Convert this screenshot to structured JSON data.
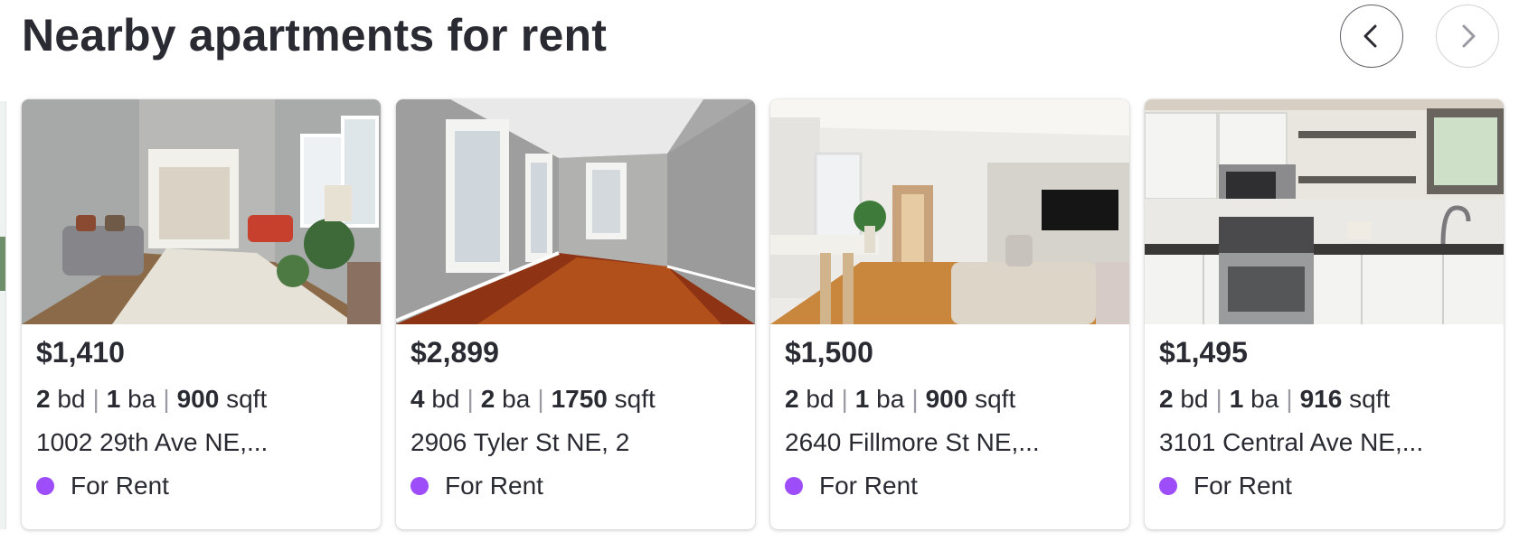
{
  "header": {
    "title": "Nearby apartments for rent",
    "prev_icon": "chevron-left-icon",
    "next_icon": "chevron-right-icon"
  },
  "colors": {
    "text": "#2a2a33",
    "status_dot": "#9e4dfb",
    "separator": "#9a9aa2"
  },
  "listings": [
    {
      "price": "$1,410",
      "beds": "2",
      "beds_unit": "bd",
      "baths": "1",
      "baths_unit": "ba",
      "sqft": "900",
      "sqft_unit": "sqft",
      "address": "1002 29th Ave NE,...",
      "status": "For Rent",
      "photo": "living-room-photo"
    },
    {
      "price": "$2,899",
      "beds": "4",
      "beds_unit": "bd",
      "baths": "2",
      "baths_unit": "ba",
      "sqft": "1750",
      "sqft_unit": "sqft",
      "address": "2906 Tyler St NE, 2",
      "status": "For Rent",
      "photo": "empty-room-photo"
    },
    {
      "price": "$1,500",
      "beds": "2",
      "beds_unit": "bd",
      "baths": "1",
      "baths_unit": "ba",
      "sqft": "900",
      "sqft_unit": "sqft",
      "address": "2640 Fillmore St NE,...",
      "status": "For Rent",
      "photo": "living-area-photo"
    },
    {
      "price": "$1,495",
      "beds": "2",
      "beds_unit": "bd",
      "baths": "1",
      "baths_unit": "ba",
      "sqft": "916",
      "sqft_unit": "sqft",
      "address": "3101 Central Ave NE,...",
      "status": "For Rent",
      "photo": "kitchen-photo"
    }
  ]
}
